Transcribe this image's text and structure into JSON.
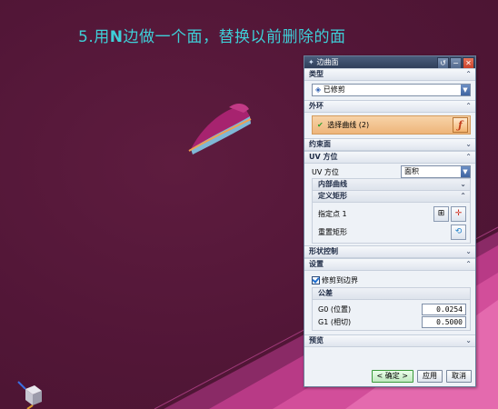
{
  "slide_title": {
    "number": "5.",
    "prefix": "用",
    "bold": "N",
    "rest": "边做一个面，替换以前删除的面"
  },
  "dialog": {
    "title": "边曲面",
    "title_buttons": [
      "↺",
      "−",
      "✕"
    ],
    "type": {
      "header": "类型",
      "value": "已修剪"
    },
    "outer_loop": {
      "header": "外环",
      "select_curve": "选择曲线 (2)"
    },
    "constraint_face": {
      "header": "约束面"
    },
    "uv": {
      "header": "UV 方位",
      "label": "UV 方位",
      "value": "面积",
      "inner_curve": "内部曲线",
      "define_rect": "定义矩形",
      "specify_point": "指定点 1",
      "reset_rect": "重置矩形"
    },
    "shape_control": {
      "header": "形状控制"
    },
    "settings": {
      "header": "设置",
      "trim_to_boundary": "修剪到边界",
      "tolerance": "公差",
      "g0_label": "G0 (位置)",
      "g0_value": "0.0254",
      "g1_label": "G1 (相切)",
      "g1_value": "0.5000"
    },
    "preview": {
      "header": "预览"
    },
    "buttons": {
      "ok": "< 确定 >",
      "apply": "应用",
      "cancel": "取消"
    }
  },
  "colors": {
    "viewport": "#521637",
    "accent_title": "#3ecfd8",
    "selection": "#eeb57a"
  }
}
